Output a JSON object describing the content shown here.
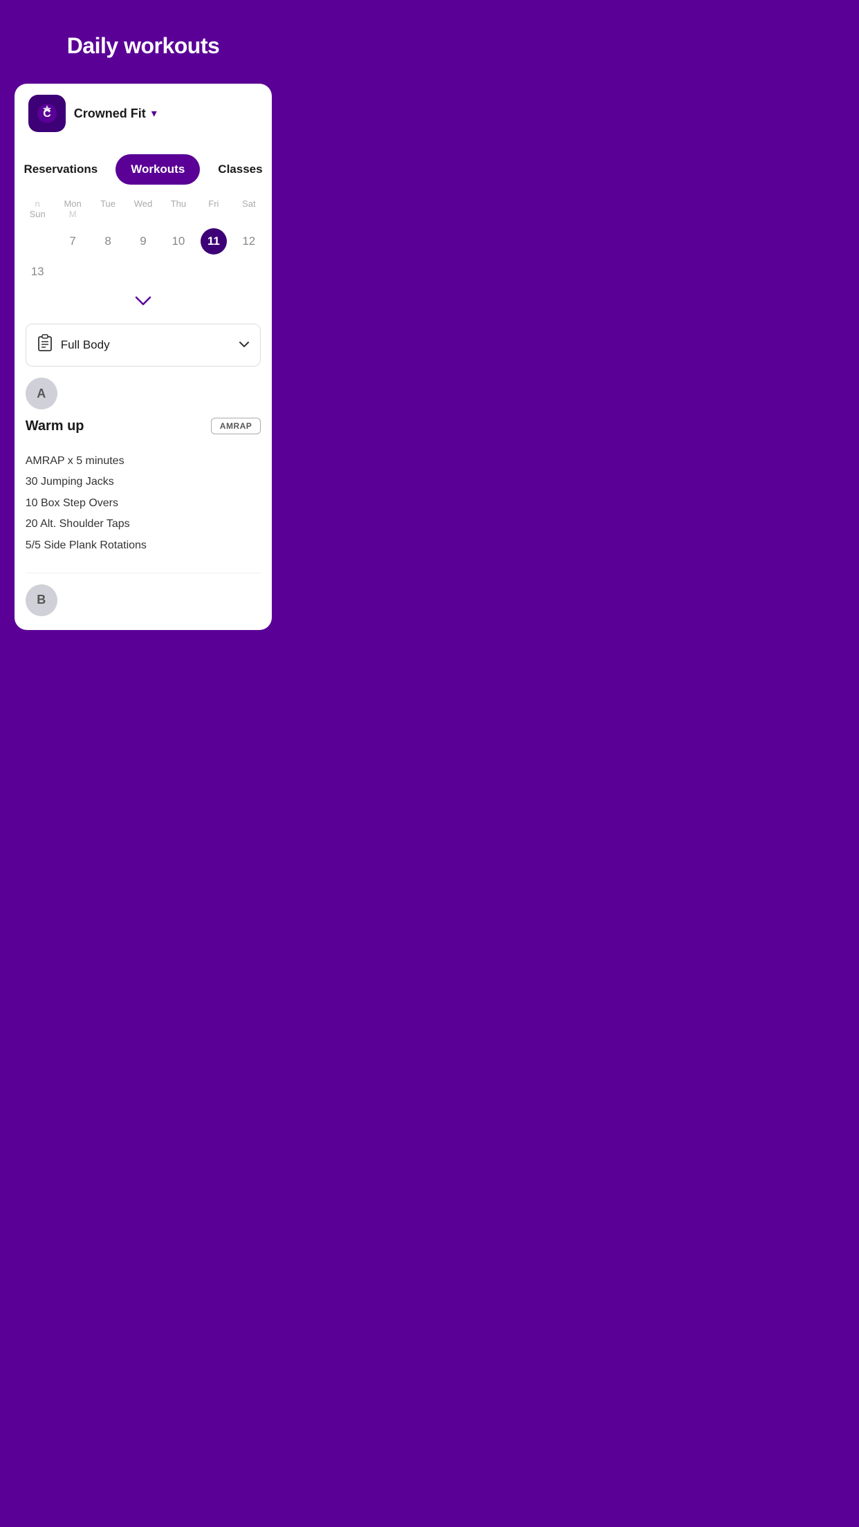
{
  "header": {
    "title": "Daily  workouts"
  },
  "gym": {
    "name": "Crowned Fit",
    "dropdown_icon": "▾"
  },
  "tabs": [
    {
      "id": "reservations",
      "label": "Reservations",
      "active": false
    },
    {
      "id": "workouts",
      "label": "Workouts",
      "active": true
    },
    {
      "id": "classes",
      "label": "Classes",
      "active": false
    }
  ],
  "calendar": {
    "days": [
      "n",
      "Mon",
      "Tue",
      "Wed",
      "Thu",
      "Fri",
      "Sat",
      "Sun",
      "M"
    ],
    "display_days": [
      "Mon",
      "Tue",
      "Wed",
      "Thu",
      "Fri",
      "Sat",
      "Sun"
    ],
    "dates": [
      "7",
      "8",
      "9",
      "10",
      "11",
      "12",
      "13"
    ],
    "selected_date": "11",
    "expand_icon": "⌄"
  },
  "workout_type": {
    "label": "Full Body",
    "icon": "📋"
  },
  "section_a": {
    "label": "A"
  },
  "warmup": {
    "title": "Warm up",
    "badge": "AMRAP",
    "lines": [
      "AMRAP x 5 minutes",
      "30 Jumping Jacks",
      "10 Box Step Overs",
      "20 Alt. Shoulder Taps",
      "5/5 Side Plank Rotations"
    ]
  },
  "section_b": {
    "label": "B"
  },
  "colors": {
    "purple_dark": "#3d0076",
    "purple_main": "#5a0096",
    "white": "#ffffff"
  }
}
